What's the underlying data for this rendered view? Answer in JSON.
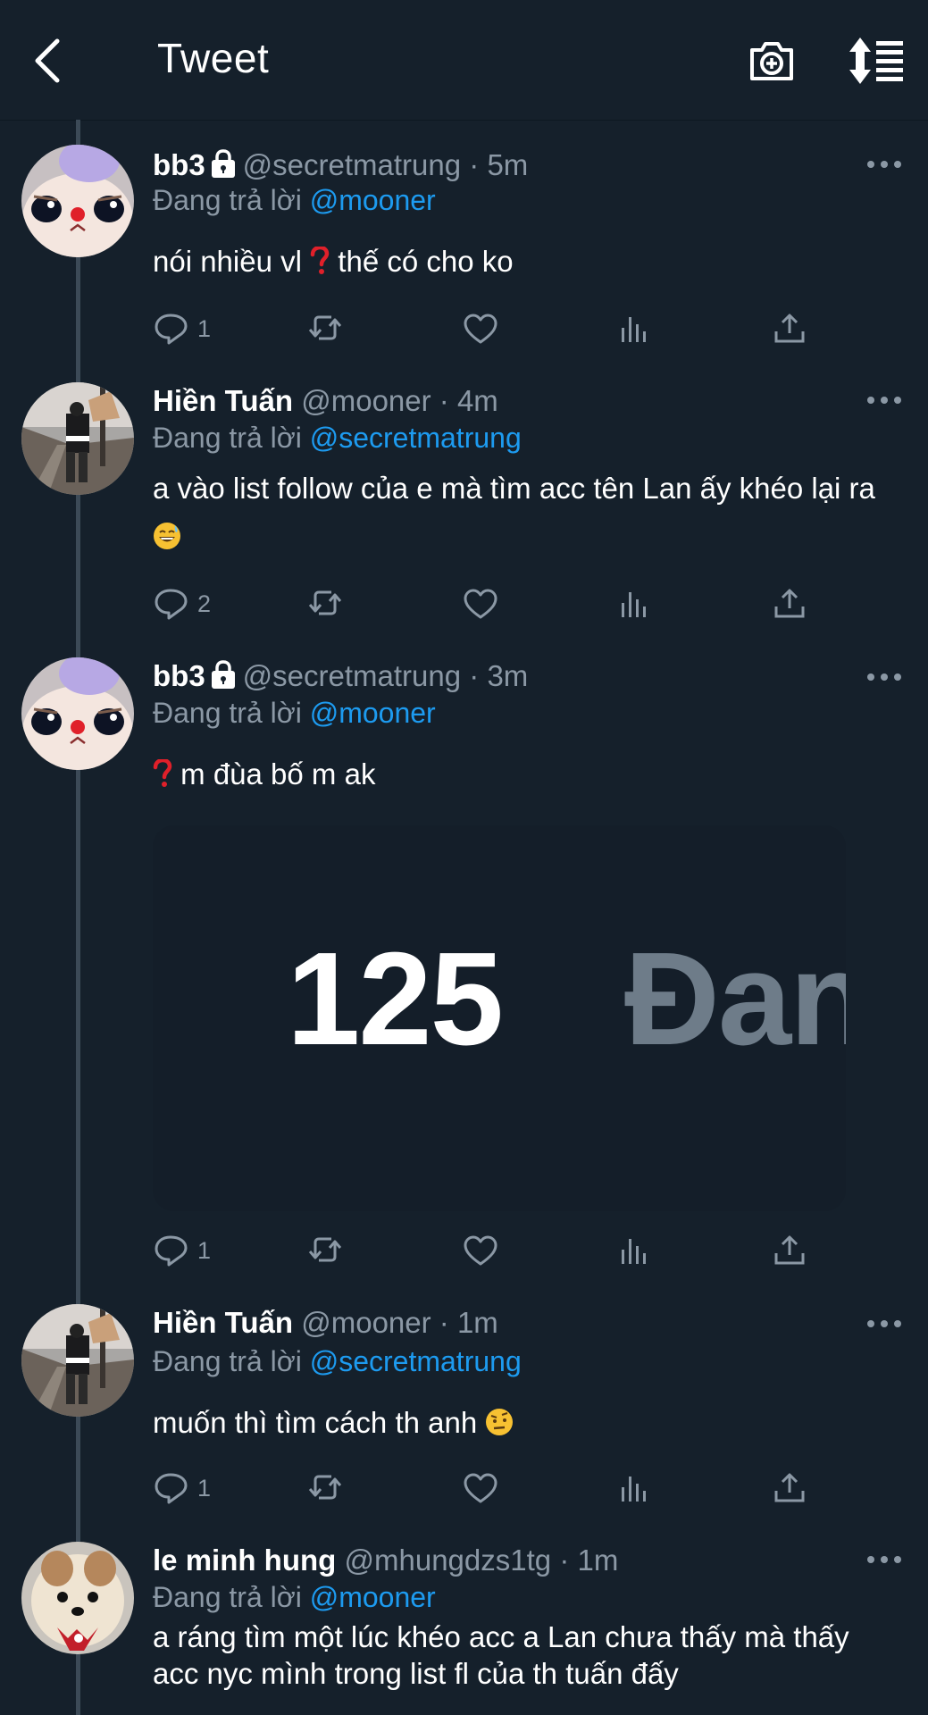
{
  "header": {
    "title": "Tweet"
  },
  "colors": {
    "background": "#15202b",
    "accent": "#1d9bf0",
    "muted": "#8b98a5"
  },
  "tweets": [
    {
      "name": "bb3",
      "protected": true,
      "handle": "@secretmatrung",
      "time": "· 5m",
      "reply_prefix": "Đang trả lời",
      "reply_to": "@mooner",
      "text_a": "nói nhiều vl ",
      "emoji": "❓",
      "text_b": " thế có cho ko",
      "replies": "1"
    },
    {
      "name": "Hiền Tuấn",
      "protected": false,
      "handle": "@mooner",
      "time": "· 4m",
      "reply_prefix": "Đang trả lời",
      "reply_to": "@secretmatrung",
      "text_a": "a vào list follow của e mà tìm acc tên Lan ấy khéo lại ra ",
      "emoji": "😅",
      "replies": "2"
    },
    {
      "name": "bb3",
      "protected": true,
      "handle": "@secretmatrung",
      "time": "· 3m",
      "reply_prefix": "Đang trả lời",
      "reply_to": "@mooner",
      "emoji": "❓",
      "text_b": " m đùa bố m ak",
      "media_number": "125",
      "media_text": "Đan",
      "replies": "1"
    },
    {
      "name": "Hiền Tuấn",
      "protected": false,
      "handle": "@mooner",
      "time": "· 1m",
      "reply_prefix": "Đang trả lời",
      "reply_to": "@secretmatrung",
      "text_a": "muốn thì tìm cách th anh ",
      "emoji": "🤨",
      "replies": "1"
    },
    {
      "name": "le minh hung",
      "protected": false,
      "handle": "@mhungdzs1tg",
      "time": "· 1m",
      "reply_prefix": "Đang trả lời",
      "reply_to": "@mooner",
      "text_a": "a ráng tìm một lúc khéo acc a Lan chưa thấy mà thấy acc nyc mình trong list fl của th tuấn đấy"
    }
  ],
  "icons": {
    "back": "back-arrow-icon",
    "camera": "camera-plus-icon",
    "sort": "sort-icon",
    "reply": "reply-icon",
    "retweet": "retweet-icon",
    "like": "heart-icon",
    "analytics": "analytics-icon",
    "share": "share-icon",
    "more": "more-icon",
    "lock": "lock-icon"
  }
}
